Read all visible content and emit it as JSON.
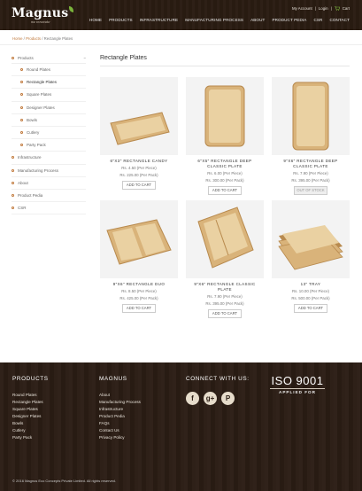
{
  "header": {
    "logo_text": "Magnus",
    "logo_tagline": "we innovate",
    "top_links": [
      "My Account",
      "Login",
      "Cart"
    ],
    "nav": [
      "HOME",
      "PRODUCTS",
      "INFRASTRUCTURE",
      "MANUFACTURING PROCESS",
      "ABOUT",
      "PRODUCT PEDIA",
      "CSR",
      "CONTACT"
    ]
  },
  "breadcrumb": {
    "home": "Home",
    "sep": " / ",
    "products": "Products",
    "current": "Rectangle Plates"
  },
  "sidebar": {
    "heading": "Products",
    "toggle": "−",
    "sub_items": [
      "Round Plates",
      "Rectangle Plates",
      "Square Plates",
      "Designer Plates",
      "Bowls",
      "Cutlery",
      "Party Pack"
    ],
    "items": [
      "Infrastructure",
      "Manufacturing Process",
      "About",
      "Product Pedia",
      "CSR"
    ]
  },
  "main": {
    "title": "Rectangle Plates",
    "products": [
      {
        "name": "6\"X3\" RECTANGLE CANDY",
        "name2": "",
        "price1": "Rs. 4.50 (Per Piece)",
        "price2": "Rs. 225.00 (Per Pack)",
        "button": "ADD TO CART",
        "shape": "rect-tilt"
      },
      {
        "name": "6\"X5\" RECTANGLE DEEP",
        "name2": "CLASSIC PLATE",
        "price1": "Rs. 6.00 (Per Piece)",
        "price2": "Rs. 300.00 (Per Pack)",
        "button": "ADD TO CART",
        "shape": "rect-deep"
      },
      {
        "name": "9\"X6\" RECTANGLE DEEP",
        "name2": "CLASSIC PLATE",
        "price1": "Rs. 7.90 (Per Piece)",
        "price2": "Rs. 395.00 (Per Pack)",
        "button": "OUT OF STOCK",
        "shape": "rect-tall"
      },
      {
        "name": "9\"X6\" RECTANGLE DUO",
        "name2": "",
        "price1": "Rs. 8.50 (Per Piece)",
        "price2": "Rs. 425.00 (Per Pack)",
        "button": "ADD TO CART",
        "shape": "duo"
      },
      {
        "name": "9\"X6\" RECTANGLE CLASSIC",
        "name2": "PLATE",
        "price1": "Rs. 7.90 (Per Piece)",
        "price2": "Rs. 395.00 (Per Pack)",
        "button": "ADD TO CART",
        "shape": "classic"
      },
      {
        "name": "13\" TRAY",
        "name2": "",
        "price1": "Rs. 10.00 (Per Piece)",
        "price2": "Rs. 500.00 (Per Pack)",
        "button": "ADD TO CART",
        "shape": "stack"
      }
    ]
  },
  "footer": {
    "products_head": "PRODUCTS",
    "products": [
      "Round Plates",
      "Rectangle Plates",
      "Square Plates",
      "Designer Plates",
      "Bowls",
      "Cutlery",
      "Party Pack"
    ],
    "magnus_head": "MAGNUS",
    "magnus": [
      "About",
      "Manufacturing Process",
      "Infrastructure",
      "Product Pedia",
      "FAQs",
      "Contact Us",
      "Privacy Policy"
    ],
    "connect_head": "CONNECT WITH US:",
    "socials": [
      {
        "name": "facebook-icon",
        "glyph": "f"
      },
      {
        "name": "google-plus-icon",
        "glyph": "g+"
      },
      {
        "name": "pinterest-icon",
        "glyph": "P"
      }
    ],
    "iso_title": "ISO 9001",
    "iso_sub": "APPLIED FOR",
    "copyright": "© 2016 Magnus Eco Concepts Private Limited. All rights reserved."
  },
  "colors": {
    "accent": "#c0783a",
    "header_bg": "#2a1c12",
    "footer_bg": "#2b1d14",
    "leaf": "#7ab33b"
  }
}
